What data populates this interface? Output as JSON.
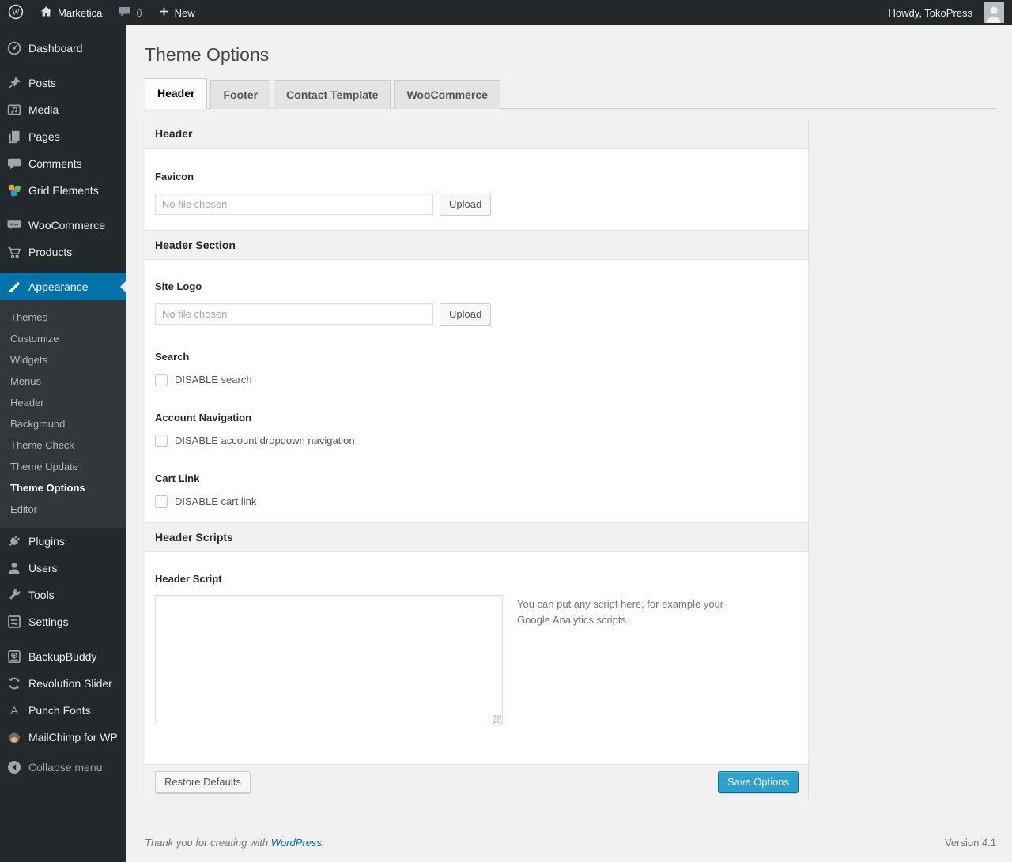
{
  "admin_bar": {
    "site_name": "Marketica",
    "comment_count": "0",
    "new_label": "New",
    "howdy": "Howdy, TokoPress"
  },
  "sidebar": {
    "items": [
      {
        "label": "Dashboard"
      },
      {
        "label": "Posts"
      },
      {
        "label": "Media"
      },
      {
        "label": "Pages"
      },
      {
        "label": "Comments"
      },
      {
        "label": "Grid Elements"
      },
      {
        "label": "WooCommerce"
      },
      {
        "label": "Products"
      },
      {
        "label": "Appearance"
      },
      {
        "label": "Plugins"
      },
      {
        "label": "Users"
      },
      {
        "label": "Tools"
      },
      {
        "label": "Settings"
      },
      {
        "label": "BackupBuddy"
      },
      {
        "label": "Revolution Slider"
      },
      {
        "label": "Punch Fonts"
      },
      {
        "label": "MailChimp for WP"
      },
      {
        "label": "Collapse menu"
      }
    ],
    "appearance_submenu": [
      {
        "label": "Themes"
      },
      {
        "label": "Customize"
      },
      {
        "label": "Widgets"
      },
      {
        "label": "Menus"
      },
      {
        "label": "Header"
      },
      {
        "label": "Background"
      },
      {
        "label": "Theme Check"
      },
      {
        "label": "Theme Update"
      },
      {
        "label": "Theme Options",
        "active": true
      },
      {
        "label": "Editor"
      }
    ]
  },
  "page": {
    "title": "Theme Options",
    "tabs": [
      {
        "label": "Header",
        "active": true
      },
      {
        "label": "Footer"
      },
      {
        "label": "Contact Template"
      },
      {
        "label": "WooCommerce"
      }
    ]
  },
  "panel": {
    "sections": {
      "header": {
        "title": "Header"
      },
      "header_section": {
        "title": "Header Section"
      },
      "header_scripts": {
        "title": "Header Scripts"
      }
    },
    "favicon": {
      "label": "Favicon",
      "placeholder": "No file chosen",
      "upload_label": "Upload"
    },
    "site_logo": {
      "label": "Site Logo",
      "placeholder": "No file chosen",
      "upload_label": "Upload"
    },
    "search": {
      "label": "Search",
      "checkbox_label": "DISABLE search",
      "checked": false
    },
    "account_navigation": {
      "label": "Account Navigation",
      "checkbox_label": "DISABLE account dropdown navigation",
      "checked": false
    },
    "cart_link": {
      "label": "Cart Link",
      "checkbox_label": "DISABLE cart link",
      "checked": false
    },
    "header_script": {
      "label": "Header Script",
      "value": "",
      "help_text": "You can put any script here, for example your Google Analytics scripts."
    },
    "actions": {
      "restore_label": "Restore Defaults",
      "save_label": "Save Options"
    }
  },
  "page_footer": {
    "thanks_text": "Thank you for creating with ",
    "wordpress_link_label": "WordPress",
    "thanks_period": ".",
    "version": "Version 4.1"
  },
  "colors": {
    "admin_bar_bg": "#23282d",
    "submenu_bg": "#32373c",
    "accent_blue": "#0073aa",
    "primary_button": "#2ea2cc",
    "content_bg": "#f1f1f1"
  }
}
